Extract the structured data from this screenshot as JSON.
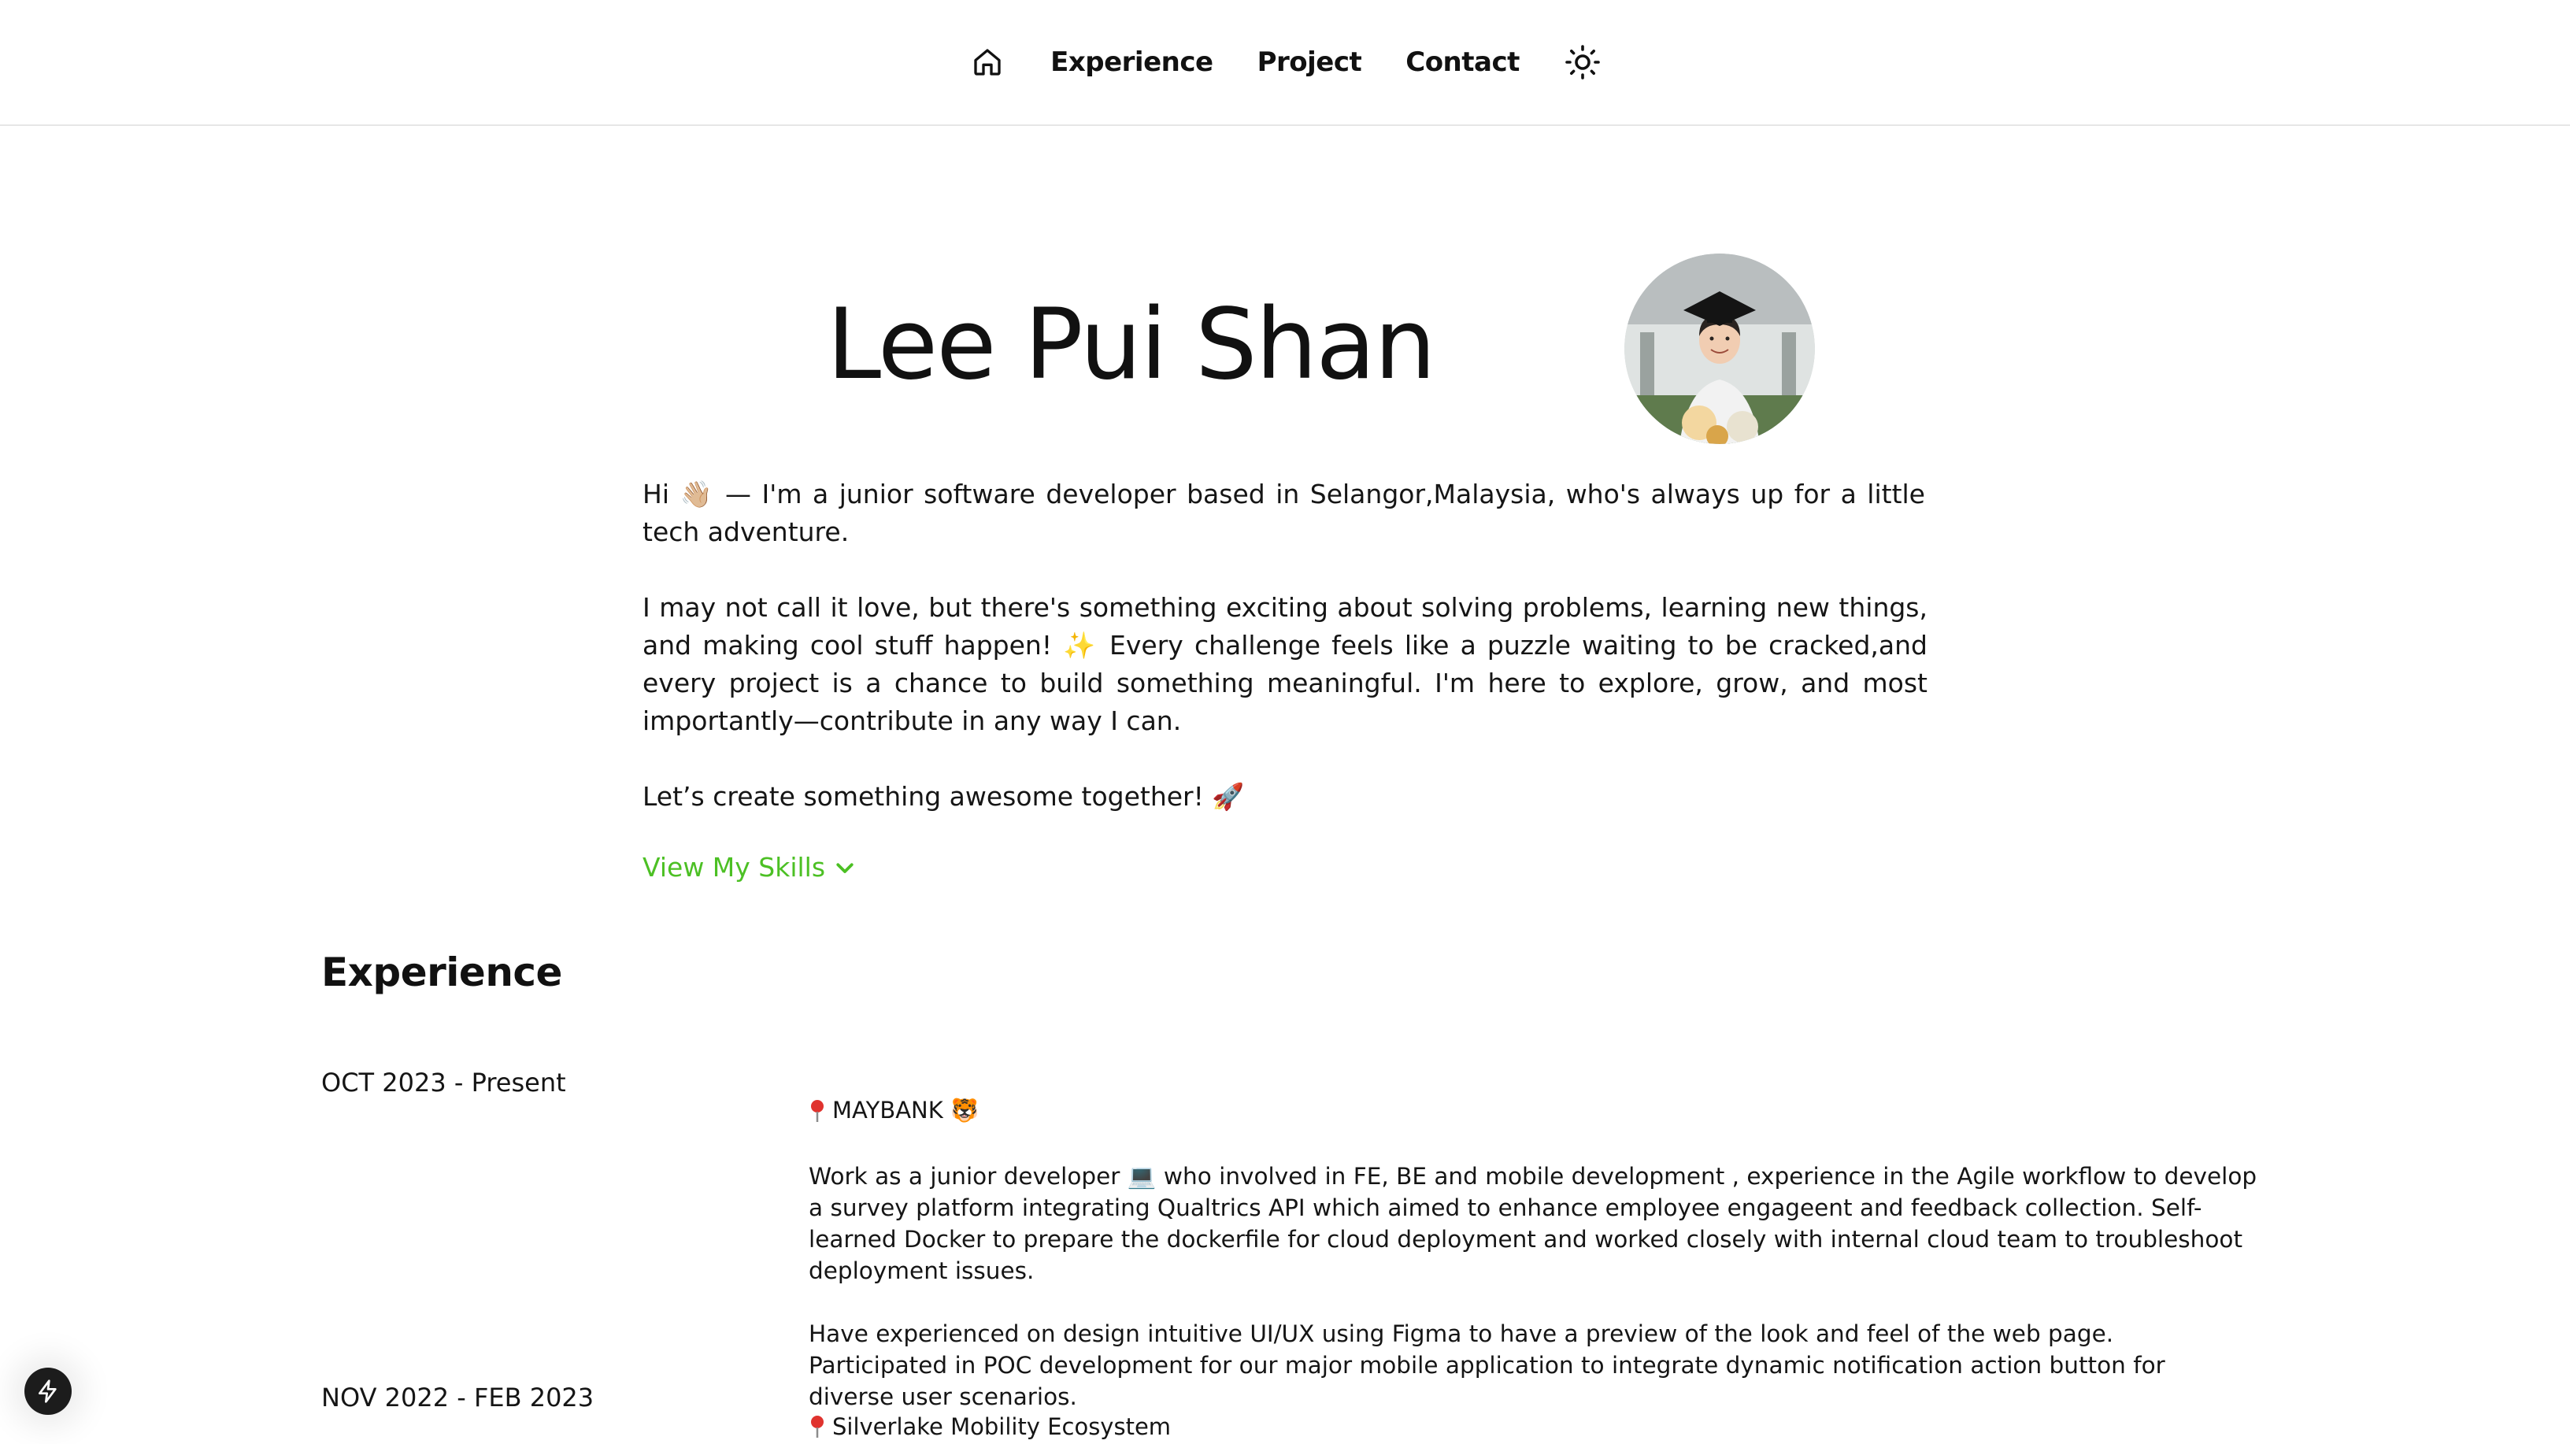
{
  "nav": {
    "home_icon": "home-icon",
    "links": [
      "Experience",
      "Project",
      "Contact"
    ],
    "theme_icon": "sun-icon"
  },
  "hero": {
    "name": "Lee Pui Shan",
    "avatar_icon": "profile-photo"
  },
  "intro": {
    "para1": "Hi 👋🏼 — I'm a junior software developer based in Selangor,Malaysia, who's always up for a little tech adventure.",
    "para2": "I may not call it love, but there's something exciting about solving problems, learning new things, and making cool stuff happen! ✨ Every challenge feels like a puzzle waiting to be cracked,and every project is a chance to build something meaningful. I'm here to explore, grow, and most importantly—contribute in any way I can.",
    "para3": "Let’s create something awesome together! 🚀"
  },
  "skills": {
    "label": "View My Skills",
    "icon": "chevron-down-icon",
    "color": "#4cc024"
  },
  "experience": {
    "heading": "Experience",
    "items": [
      {
        "date": "OCT 2023 - Present",
        "company": "MAYBANK 🐯",
        "desc1": "Work as a junior developer 💻 who involved in FE, BE and mobile development , experience in the Agile workflow to develop a survey platform integrating Qualtrics API which aimed to enhance employee engageent and feedback collection. Self-learned Docker to prepare the dockerfile for cloud deployment and worked closely with internal cloud team to troubleshoot deployment issues.",
        "desc2": "Have experienced on design intuitive UI/UX using Figma to have a preview of the look and feel of the web page. Participated in POC development for our major mobile application to integrate dynamic notification action button for diverse user scenarios."
      },
      {
        "date": "NOV 2022 - FEB 2023",
        "company": "Silverlake Mobility Ecosystem"
      }
    ]
  },
  "float_button": {
    "icon": "lightning-icon"
  }
}
